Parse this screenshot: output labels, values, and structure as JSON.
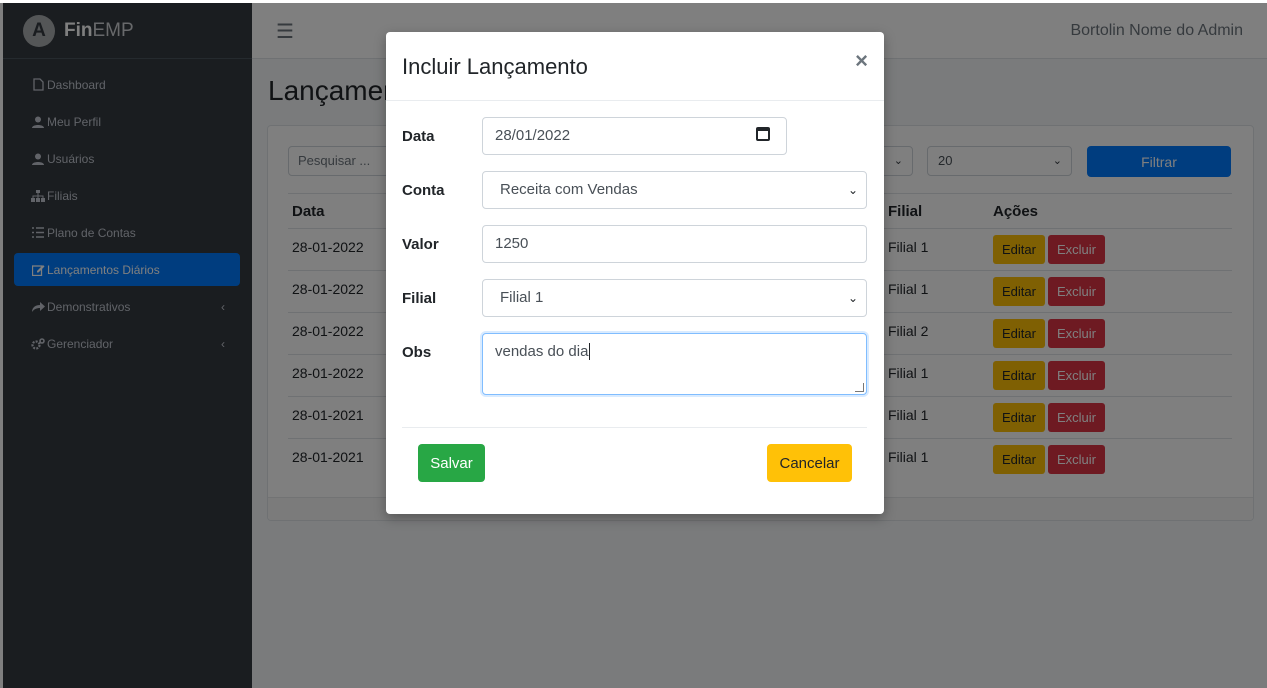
{
  "brand": {
    "logo_letter": "A",
    "name_bold": "Fin",
    "name_light": "EMP"
  },
  "sidebar": {
    "items": [
      {
        "label": "Dashboard",
        "icon": "file-icon"
      },
      {
        "label": "Meu Perfil",
        "icon": "user-icon"
      },
      {
        "label": "Usuários",
        "icon": "user-icon"
      },
      {
        "label": "Filiais",
        "icon": "sitemap-icon"
      },
      {
        "label": "Plano de Contas",
        "icon": "list-icon"
      },
      {
        "label": "Lançamentos Diários",
        "icon": "edit-icon",
        "active": true
      },
      {
        "label": "Demonstrativos",
        "icon": "share-icon",
        "expandable": true
      },
      {
        "label": "Gerenciador",
        "icon": "cogs-icon",
        "expandable": true
      }
    ]
  },
  "topbar": {
    "admin_name": "Bortolin Nome do Admin"
  },
  "page": {
    "title": "Lançamentos Diários"
  },
  "filters": {
    "search_placeholder": "Pesquisar ...",
    "select_2_value": "20",
    "filter_button": "Filtrar"
  },
  "table": {
    "headers": {
      "data": "Data",
      "filial": "Filial",
      "acoes": "Ações"
    },
    "rows": [
      {
        "data": "28-01-2022",
        "filial": "Filial 1"
      },
      {
        "data": "28-01-2022",
        "filial": "Filial 1"
      },
      {
        "data": "28-01-2022",
        "filial": "Filial 2"
      },
      {
        "data": "28-01-2022",
        "filial": "Filial 1"
      },
      {
        "data": "28-01-2021",
        "filial": "Filial 1"
      },
      {
        "data": "28-01-2021",
        "filial": "Filial 1"
      }
    ],
    "edit_label": "Editar",
    "delete_label": "Excluir"
  },
  "modal": {
    "title": "Incluir Lançamento",
    "close_symbol": "×",
    "fields": {
      "data": {
        "label": "Data",
        "value": "28/01/2022"
      },
      "conta": {
        "label": "Conta",
        "value": "Receita com Vendas"
      },
      "valor": {
        "label": "Valor",
        "value": "1250"
      },
      "filial": {
        "label": "Filial",
        "value": "Filial 1"
      },
      "obs": {
        "label": "Obs",
        "value": "vendas do dia"
      }
    },
    "save_label": "Salvar",
    "cancel_label": "Cancelar"
  },
  "colors": {
    "sidebar_bg": "#343a40",
    "primary": "#007bff",
    "success": "#28a745",
    "warning": "#ffc107",
    "danger": "#dc3545"
  }
}
